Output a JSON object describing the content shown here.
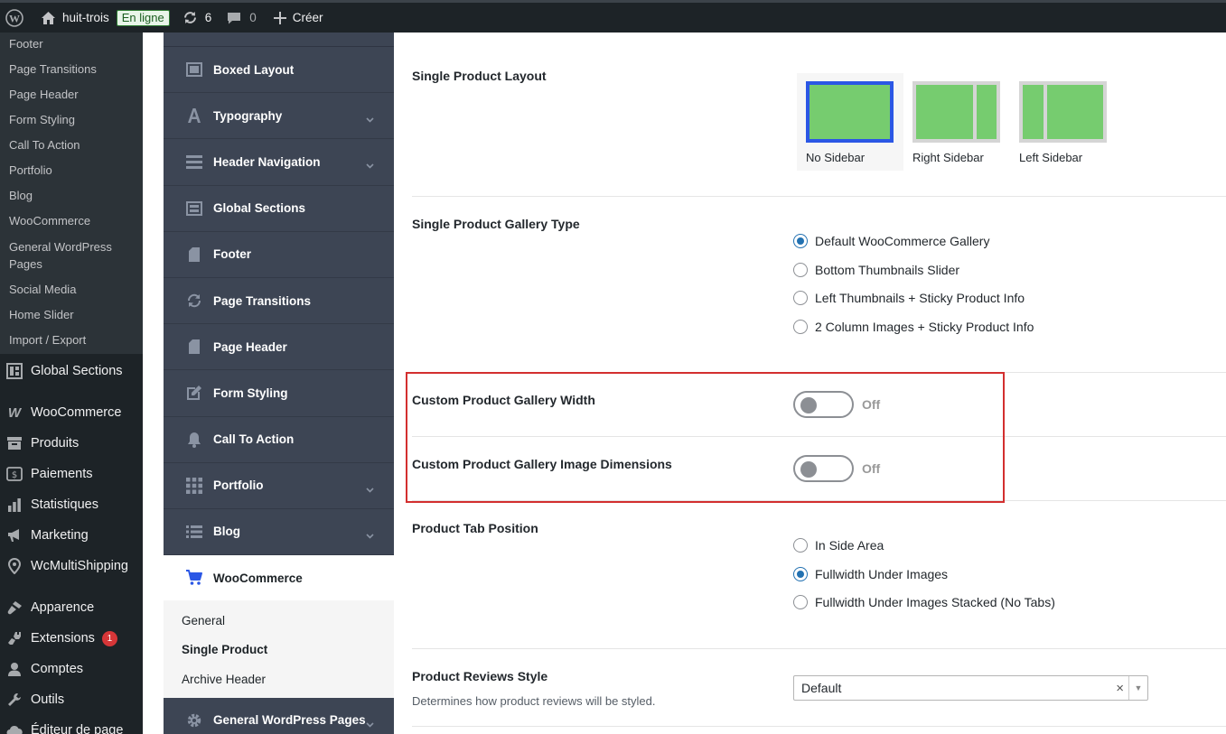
{
  "adminbar": {
    "site_name": "huit-trois",
    "online_badge": "En ligne",
    "updates_count": "6",
    "comments_count": "0",
    "create_label": "Créer"
  },
  "wp_submenu": [
    "Footer",
    "Page Transitions",
    "Page Header",
    "Form Styling",
    "Call To Action",
    "Portfolio",
    "Blog",
    "WooCommerce",
    "General WordPress Pages",
    "Social Media",
    "Home Slider",
    "Import / Export"
  ],
  "wp_menu": {
    "global_sections": "Global Sections",
    "woocommerce": "WooCommerce",
    "produits": "Produits",
    "paiements": "Paiements",
    "statistiques": "Statistiques",
    "marketing": "Marketing",
    "wcmultishipping": "WcMultiShipping",
    "apparence": "Apparence",
    "extensions": "Extensions",
    "extensions_badge": "1",
    "comptes": "Comptes",
    "outils": "Outils",
    "editeur": "Éditeur de page"
  },
  "theme_panel": {
    "items": [
      {
        "label": "Boxed Layout",
        "icon": "boxed-layout-icon",
        "chevron": false
      },
      {
        "label": "Typography",
        "icon": "typography-icon",
        "chevron": true
      },
      {
        "label": "Header Navigation",
        "icon": "header-navigation-icon",
        "chevron": true
      },
      {
        "label": "Global Sections",
        "icon": "global-sections-icon",
        "chevron": false
      },
      {
        "label": "Footer",
        "icon": "footer-icon",
        "chevron": false
      },
      {
        "label": "Page Transitions",
        "icon": "page-transitions-icon",
        "chevron": false
      },
      {
        "label": "Page Header",
        "icon": "page-header-icon",
        "chevron": false
      },
      {
        "label": "Form Styling",
        "icon": "form-styling-icon",
        "chevron": false
      },
      {
        "label": "Call To Action",
        "icon": "bell-icon",
        "chevron": false
      },
      {
        "label": "Portfolio",
        "icon": "grid-icon",
        "chevron": true
      },
      {
        "label": "Blog",
        "icon": "list-icon",
        "chevron": true
      }
    ],
    "active_item": "WooCommerce",
    "sub_items": [
      "General",
      "Single Product",
      "Archive Header"
    ],
    "current_sub": "Single Product",
    "bottom_item": "General WordPress Pages"
  },
  "settings": {
    "single_product_layout": {
      "label": "Single Product Layout",
      "options": [
        "No Sidebar",
        "Right Sidebar",
        "Left Sidebar"
      ],
      "selected": "No Sidebar"
    },
    "gallery_type": {
      "label": "Single Product Gallery Type",
      "options": [
        "Default WooCommerce Gallery",
        "Bottom Thumbnails Slider",
        "Left Thumbnails + Sticky Product Info",
        "2 Column Images + Sticky Product Info"
      ],
      "selected": "Default WooCommerce Gallery"
    },
    "custom_gallery_width": {
      "label": "Custom Product Gallery Width",
      "state": "Off"
    },
    "custom_gallery_dimensions": {
      "label": "Custom Product Gallery Image Dimensions",
      "state": "Off"
    },
    "product_tab_position": {
      "label": "Product Tab Position",
      "options": [
        "In Side Area",
        "Fullwidth Under Images",
        "Fullwidth Under Images Stacked (No Tabs)"
      ],
      "selected": "Fullwidth Under Images"
    },
    "product_reviews_style": {
      "label": "Product Reviews Style",
      "description": "Determines how product reviews will be styled.",
      "value": "Default"
    }
  },
  "colors": {
    "accent": "#2b57e5",
    "highlight_box": "#d32f2f",
    "layout_green": "#76cc6f"
  }
}
